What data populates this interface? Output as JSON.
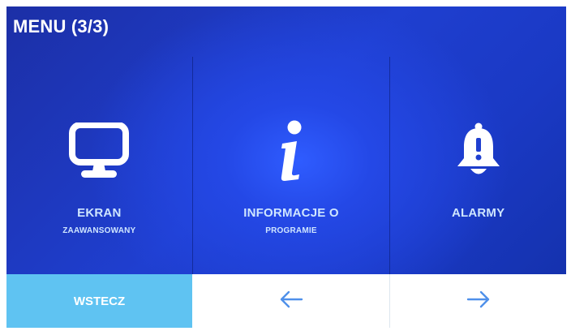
{
  "header": {
    "title": "MENU (3/3)"
  },
  "tiles": [
    {
      "icon": "monitor-icon",
      "label": "EKRAN",
      "sublabel": "ZAAWANSOWANY"
    },
    {
      "icon": "info-icon",
      "label": "INFORMACJE O",
      "sublabel": "PROGRAMIE"
    },
    {
      "icon": "bell-alarm-icon",
      "label": "ALARMY",
      "sublabel": ""
    }
  ],
  "bottom_bar": {
    "back_label": "WSTECZ",
    "prev_icon": "arrow-left-icon",
    "next_icon": "arrow-right-icon"
  },
  "colors": {
    "background": "#1f3fd0",
    "back_button": "#5fc3f2",
    "label_text": "#cfe6ff",
    "arrow": "#4f90ea"
  }
}
